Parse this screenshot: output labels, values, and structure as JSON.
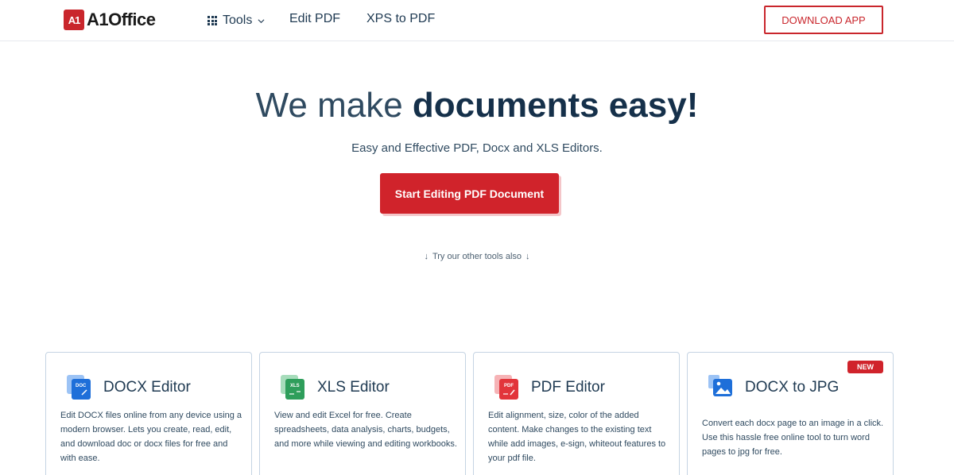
{
  "header": {
    "logo_mark": "A1",
    "logo_text": "A1Office",
    "tools_label": "Tools",
    "nav_links": [
      "Edit PDF",
      "XPS to PDF"
    ],
    "download_label": "DOWNLOAD APP"
  },
  "hero": {
    "title_light": "We make ",
    "title_bold": "documents easy!",
    "subtitle": "Easy and Effective PDF, Docx and XLS Editors.",
    "cta_label": "Start Editing PDF Document",
    "try_more": "Try our other tools also"
  },
  "cards": [
    {
      "title": "DOCX Editor",
      "icon": "docx-file-icon",
      "icon_tag": "DOC",
      "accent": "#1e6fd9",
      "description": "Edit DOCX files online from any device using a modern browser. Lets you create, read, edit, and download doc or docx files for free and with ease."
    },
    {
      "title": "XLS Editor",
      "icon": "xls-file-icon",
      "icon_tag": "XLS",
      "accent": "#2e9e5b",
      "description": "View and edit Excel for free. Create spreadsheets, data analysis, charts, budgets, and more while viewing and editing workbooks."
    },
    {
      "title": "PDF Editor",
      "icon": "pdf-file-icon",
      "icon_tag": "PDF",
      "accent": "#e2353b",
      "description": "Edit alignment, size, color of the added content. Make changes to the existing text while add images, e-sign, whiteout features to your pdf file."
    },
    {
      "title": "DOCX to JPG",
      "icon": "docx-to-image-icon",
      "icon_tag": "",
      "accent": "#1e6fd9",
      "badge": "NEW",
      "description": "Convert each docx page to an image in a click. Use this hassle free online tool to turn word pages to jpg for free."
    }
  ],
  "colors": {
    "brand_red": "#d0232b",
    "heading": "#15304a",
    "text": "#2f4a60",
    "card_border": "#c5d4e3"
  }
}
